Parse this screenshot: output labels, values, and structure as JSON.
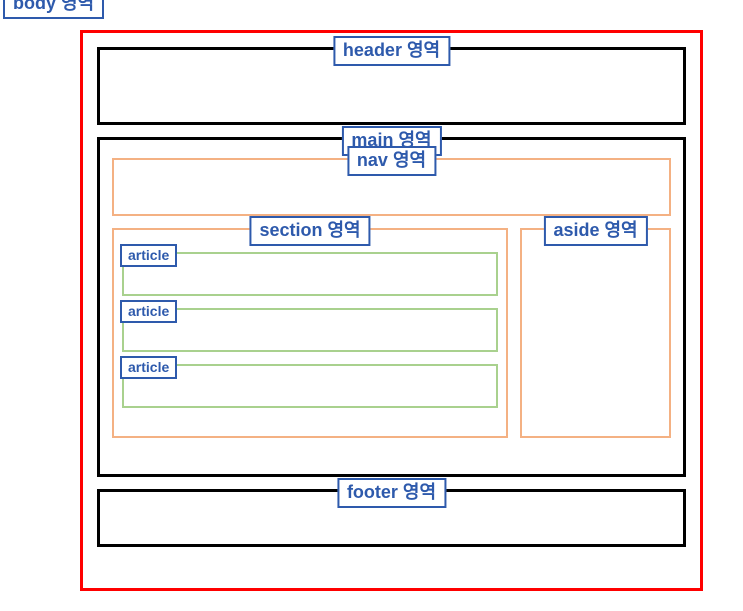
{
  "body_label": "body 영역",
  "header": {
    "label": "header 영역"
  },
  "main": {
    "label": "main 영역",
    "nav": {
      "label": "nav 영역"
    },
    "section": {
      "label": "section 영역",
      "articles": [
        {
          "label": "article"
        },
        {
          "label": "article"
        },
        {
          "label": "article"
        }
      ]
    },
    "aside": {
      "label": "aside 영역"
    }
  },
  "footer": {
    "label": "footer 영역"
  },
  "colors": {
    "body_border": "#ff0000",
    "black": "#000000",
    "orange": "#f4b183",
    "green": "#a9d18e",
    "label_blue": "#2e5aac"
  }
}
